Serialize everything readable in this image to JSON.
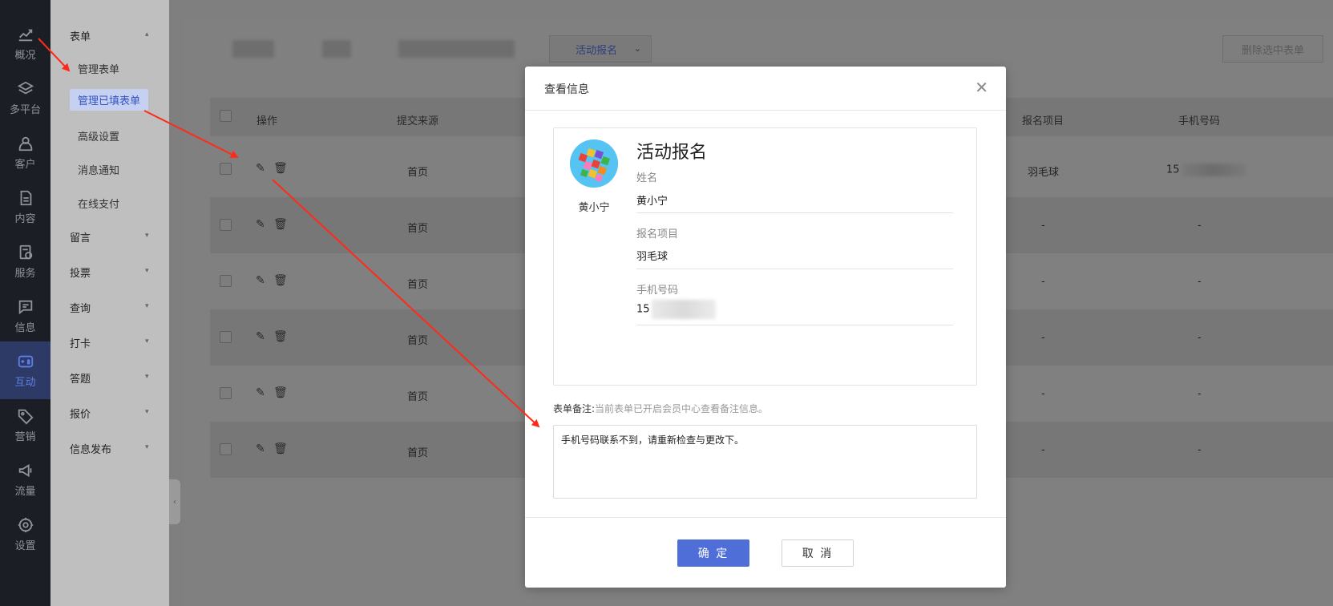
{
  "nav": {
    "items": [
      {
        "label": "概况",
        "icon": "chart-line-icon"
      },
      {
        "label": "多平台",
        "icon": "layers-icon"
      },
      {
        "label": "客户",
        "icon": "user-icon"
      },
      {
        "label": "内容",
        "icon": "document-icon"
      },
      {
        "label": "服务",
        "icon": "service-icon"
      },
      {
        "label": "信息",
        "icon": "message-icon"
      },
      {
        "label": "互动",
        "icon": "gamepad-icon",
        "active": true
      },
      {
        "label": "营销",
        "icon": "tag-icon"
      },
      {
        "label": "流量",
        "icon": "megaphone-icon"
      },
      {
        "label": "设置",
        "icon": "gear-icon"
      }
    ]
  },
  "sidebar": {
    "groups": [
      {
        "label": "表单",
        "expanded": true,
        "items": [
          "管理表单",
          "管理已填表单",
          "高级设置",
          "消息通知",
          "在线支付"
        ],
        "active_item": "管理已填表单"
      },
      {
        "label": "留言"
      },
      {
        "label": "投票"
      },
      {
        "label": "查询"
      },
      {
        "label": "打卡"
      },
      {
        "label": "答题"
      },
      {
        "label": "报价"
      },
      {
        "label": "信息发布"
      }
    ]
  },
  "toolbar": {
    "filter_value": "活动报名",
    "delete_label": "删除选中表单"
  },
  "table": {
    "headers": {
      "action": "操作",
      "source": "提交来源",
      "project": "报名项目",
      "phone": "手机号码"
    },
    "rows": [
      {
        "source": "首页",
        "project": "羽毛球",
        "phone": "15"
      },
      {
        "source": "首页",
        "project": "-",
        "phone": "-"
      },
      {
        "source": "首页",
        "project": "-",
        "phone": "-"
      },
      {
        "source": "首页",
        "project": "-",
        "phone": "-"
      },
      {
        "source": "首页",
        "project": "-",
        "phone": "-"
      },
      {
        "source": "首页",
        "project": "-",
        "phone": "-"
      }
    ]
  },
  "modal": {
    "title": "查看信息",
    "close_icon": "close-icon",
    "user_name": "黄小宁",
    "form_title": "活动报名",
    "fields": [
      {
        "label": "姓名",
        "value": "黄小宁"
      },
      {
        "label": "报名项目",
        "value": "羽毛球"
      },
      {
        "label": "手机号码",
        "value": "15"
      }
    ],
    "note_label": "表单备注:",
    "note_hint": "当前表单已开启会员中心查看备注信息。",
    "note_value": "手机号码联系不到，请重新检查与更改下。",
    "ok_label": "确 定",
    "cancel_label": "取 消"
  },
  "colors": {
    "accent": "#4f6ed7",
    "annotation": "#ff2a1a",
    "nav_bg": "#1b1e25"
  }
}
